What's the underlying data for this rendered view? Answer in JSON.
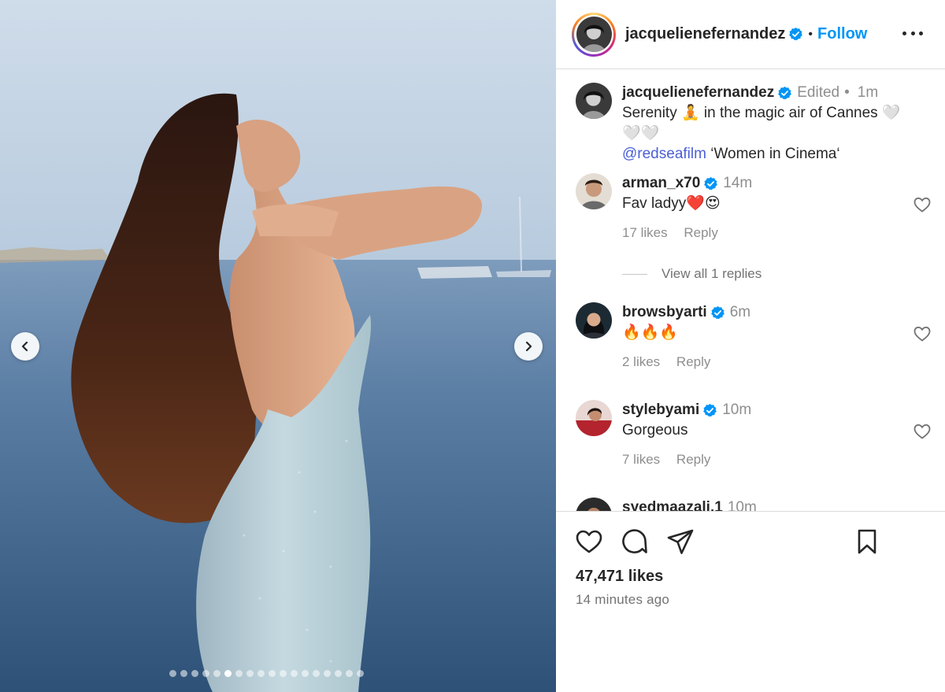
{
  "post": {
    "author": "jacquelienefernandez",
    "follow_label": "Follow",
    "separator": "•",
    "caption": {
      "username": "jacquelienefernandez",
      "edited": "Edited",
      "time": "1m",
      "text_line1": "Serenity 🧘 in the magic air of Cannes 🤍🤍🤍",
      "mention": "@redseafilm",
      "text_after_mention": " ‘Women in Cinema‘"
    },
    "likes": "47,471 likes",
    "posted": "14 minutes ago",
    "carousel": {
      "total_slides": 18,
      "active_index": 5
    }
  },
  "comments": [
    {
      "username": "arman_x70",
      "time": "14m",
      "text": "Fav ladyy❤️😍",
      "likes": "17 likes",
      "reply": "Reply",
      "view_replies": "View all 1 replies"
    },
    {
      "username": "browsbyarti",
      "time": "6m",
      "text": "🔥🔥🔥",
      "likes": "2 likes",
      "reply": "Reply"
    },
    {
      "username": "stylebyami",
      "time": "10m",
      "text": "Gorgeous",
      "likes": "7 likes",
      "reply": "Reply"
    },
    {
      "username": "syedmaazali.1",
      "time": "10m"
    }
  ],
  "icons": {
    "prev": "chevron-left-icon",
    "next": "chevron-right-icon",
    "more": "more-horizontal-icon",
    "verified": "verified-badge-icon",
    "like": "heart-icon",
    "comment": "comment-icon",
    "share": "share-icon",
    "save": "bookmark-icon"
  },
  "colors": {
    "link": "#0095f6",
    "verified": "#0095f6",
    "text": "#262626",
    "muted": "#8e8e8e"
  }
}
